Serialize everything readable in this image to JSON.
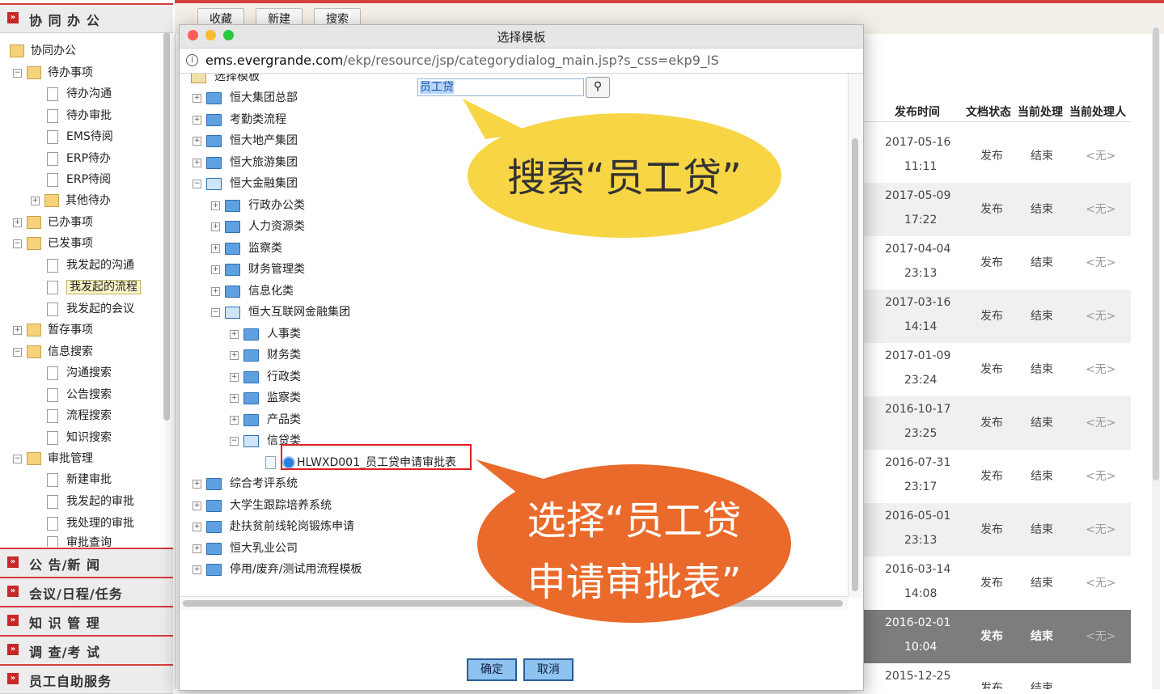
{
  "sidebar": {
    "sections_top": [
      {
        "label": "协 同 办 公"
      }
    ],
    "tree": [
      {
        "label": "协同办公"
      },
      {
        "label": "待办事项"
      },
      {
        "label": "待办沟通"
      },
      {
        "label": "待办审批"
      },
      {
        "label": "EMS待阅"
      },
      {
        "label": "ERP待办"
      },
      {
        "label": "ERP待阅"
      },
      {
        "label": "其他待办"
      },
      {
        "label": "已办事项"
      },
      {
        "label": "已发事项"
      },
      {
        "label": "我发起的沟通"
      },
      {
        "label": "我发起的流程"
      },
      {
        "label": "我发起的会议"
      },
      {
        "label": "暂存事项"
      },
      {
        "label": "信息搜索"
      },
      {
        "label": "沟通搜索"
      },
      {
        "label": "公告搜索"
      },
      {
        "label": "流程搜索"
      },
      {
        "label": "知识搜索"
      },
      {
        "label": "审批管理"
      },
      {
        "label": "新建审批"
      },
      {
        "label": "我发起的审批"
      },
      {
        "label": "我处理的审批"
      },
      {
        "label": "审批查询"
      }
    ],
    "sections_bottom": [
      {
        "label": "公 告/新 闻"
      },
      {
        "label": "会议/日程/任务"
      },
      {
        "label": "知 识 管 理"
      },
      {
        "label": "调 查/考 试"
      },
      {
        "label": "员工自助服务"
      }
    ]
  },
  "topbar": {
    "buttons": [
      "收藏",
      "新建",
      "搜索"
    ]
  },
  "table": {
    "headers": [
      "发布时间",
      "文档状态",
      "当前处理",
      "当前处理人"
    ],
    "rows": [
      {
        "date": "2017-05-16",
        "time": "11:11",
        "status": "发布",
        "proc": "结束",
        "owner": "<无>"
      },
      {
        "date": "2017-05-09",
        "time": "17:22",
        "status": "发布",
        "proc": "结束",
        "owner": "<无>"
      },
      {
        "date": "2017-04-04",
        "time": "23:13",
        "status": "发布",
        "proc": "结束",
        "owner": "<无>"
      },
      {
        "date": "2017-03-16",
        "time": "14:14",
        "status": "发布",
        "proc": "结束",
        "owner": "<无>"
      },
      {
        "date": "2017-01-09",
        "time": "23:24",
        "status": "发布",
        "proc": "结束",
        "owner": "<无>"
      },
      {
        "date": "2016-10-17",
        "time": "23:25",
        "status": "发布",
        "proc": "结束",
        "owner": "<无>"
      },
      {
        "date": "2016-07-31",
        "time": "23:17",
        "status": "发布",
        "proc": "结束",
        "owner": "<无>"
      },
      {
        "date": "2016-05-01",
        "time": "23:13",
        "status": "发布",
        "proc": "结束",
        "owner": "<无>"
      },
      {
        "date": "2016-03-14",
        "time": "14:08",
        "status": "发布",
        "proc": "结束",
        "owner": "<无>"
      },
      {
        "date": "2016-02-01",
        "time": "10:04",
        "status": "发布",
        "proc": "结束",
        "owner": "<无>"
      },
      {
        "date": "2015-12-25",
        "time": "",
        "status": "发布",
        "proc": "结束",
        "owner": ""
      }
    ]
  },
  "dialog": {
    "title": "选择模板",
    "url_host": "ems.evergrande.com",
    "url_path": "/ekp/resource/jsp/categorydialog_main.jsp?s_css=ekp9_IS",
    "root_label": "选择模板",
    "search_value": "员工贷",
    "tree": [
      {
        "label": "恒大集团总部"
      },
      {
        "label": "考勤类流程"
      },
      {
        "label": "恒大地产集团"
      },
      {
        "label": "恒大旅游集团"
      },
      {
        "label": "恒大金融集团"
      },
      {
        "label": "行政办公类"
      },
      {
        "label": "人力资源类"
      },
      {
        "label": "监察类"
      },
      {
        "label": "财务管理类"
      },
      {
        "label": "信息化类"
      },
      {
        "label": "恒大互联网金融集团"
      },
      {
        "label": "人事类"
      },
      {
        "label": "财务类"
      },
      {
        "label": "行政类"
      },
      {
        "label": "监察类"
      },
      {
        "label": "产品类"
      },
      {
        "label": "信贷类"
      },
      {
        "label": "HLWXD001_员工贷申请审批表"
      },
      {
        "label": "综合考评系统"
      },
      {
        "label": "大学生跟踪培养系统"
      },
      {
        "label": "赴扶贫前线轮岗锻炼申请"
      },
      {
        "label": "恒大乳业公司"
      },
      {
        "label": "停用/废弃/测试用流程模板"
      }
    ],
    "ok_label": "确定",
    "cancel_label": "取消"
  },
  "callouts": {
    "search_note": "搜索“员工贷”",
    "select_note_line1": "选择“员工贷",
    "select_note_line2": "申请审批表”"
  },
  "colors": {
    "accent_red": "#d2413a",
    "callout_yellow": "#f8d544",
    "callout_orange": "#e96a2b"
  }
}
